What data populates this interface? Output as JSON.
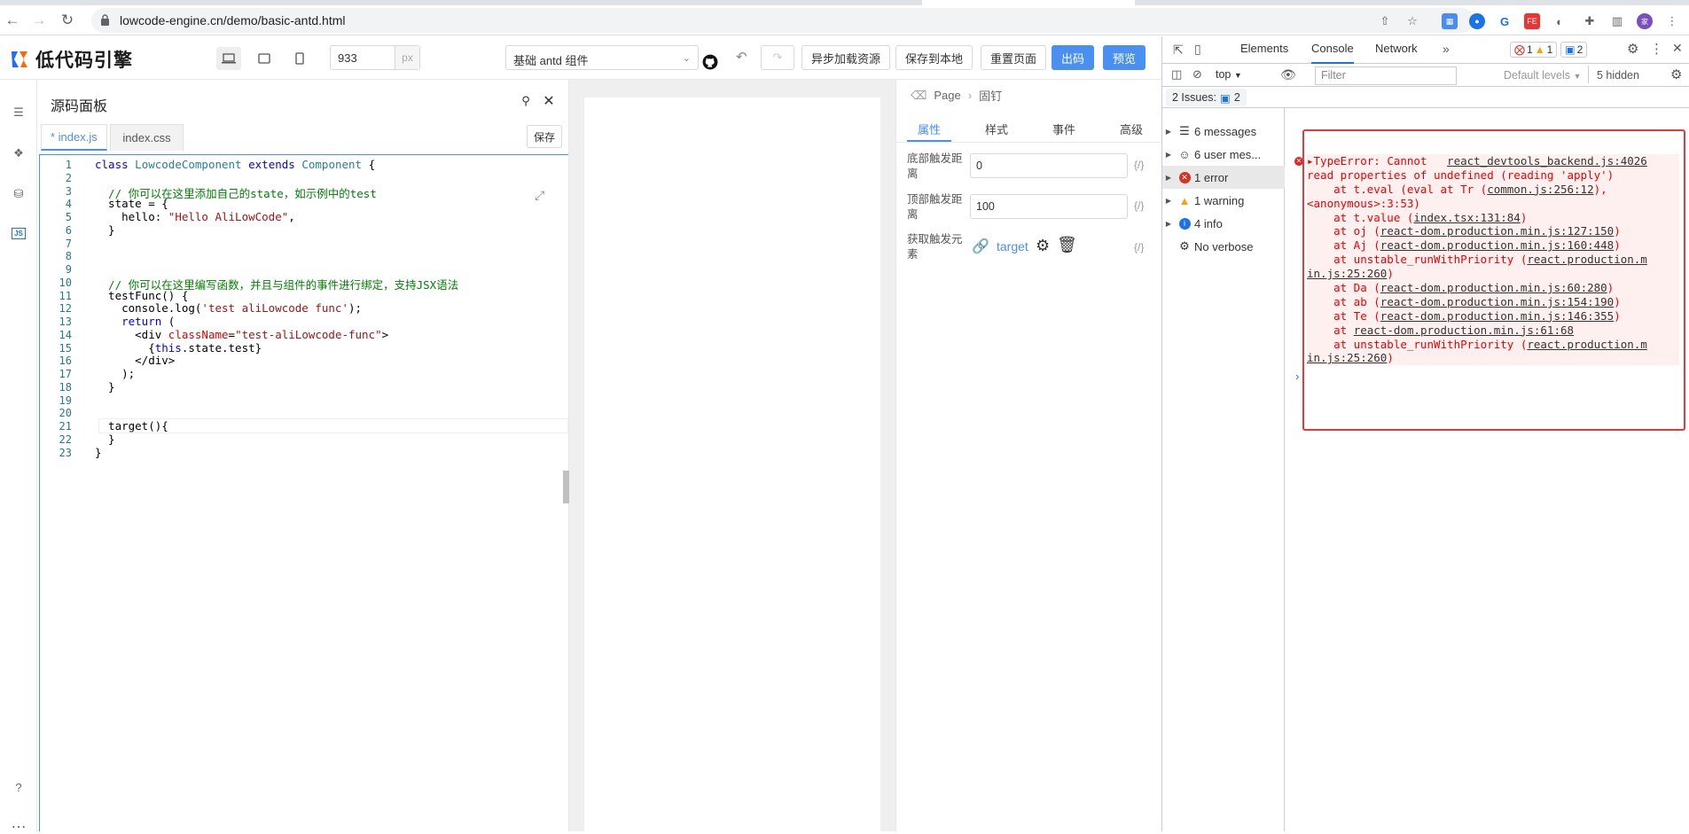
{
  "browser": {
    "url": "lowcode-engine.cn/demo/basic-antd.html"
  },
  "app": {
    "logo_text": "低代码引擎",
    "width_value": "933",
    "width_unit": "px",
    "component_select": "基础 antd 组件",
    "buttons": {
      "async_load": "异步加载资源",
      "save_local": "保存到本地",
      "reset_page": "重置页面",
      "export": "出码",
      "preview": "预览"
    }
  },
  "source_panel": {
    "title": "源码面板",
    "tabs": [
      "* index.js",
      "index.css"
    ],
    "save_label": "保存",
    "code_lines": [
      "1",
      "2",
      "3",
      "4",
      "5",
      "6",
      "7",
      "8",
      "9",
      "10",
      "11",
      "12",
      "13",
      "14",
      "15",
      "16",
      "17",
      "18",
      "19",
      "20",
      "21",
      "22",
      "23"
    ],
    "code": {
      "l1_kw": "class",
      "l1_cls": "LowcodeComponent",
      "l1_kw2": "extends",
      "l1_cls2": "Component",
      "l1_end": " {",
      "l3": "  // 你可以在这里添加自己的state，如示例中的test",
      "l4": "  state = {",
      "l5a": "    hello: ",
      "l5b": "\"Hello AliLowCode\"",
      "l5c": ",",
      "l6": "  }",
      "l10": "  // 你可以在这里编写函数，并且与组件的事件进行绑定，支持JSX语法",
      "l11": "  testFunc() {",
      "l12a": "    console.log(",
      "l12b": "'test aliLowcode func'",
      "l12c": ");",
      "l13a": "    ",
      "l13b": "return",
      "l13c": " (",
      "l14a": "      <div ",
      "l14b": "className",
      "l14c": "=",
      "l14d": "\"test-aliLowcode-func\"",
      "l14e": ">",
      "l15a": "        {",
      "l15b": "this",
      "l15c": ".state.test}",
      "l16": "      </div>",
      "l17": "    );",
      "l18": "  }",
      "l21": "  target(){",
      "l22": "  }",
      "l23": "}"
    }
  },
  "settings": {
    "breadcrumb": [
      "Page",
      "固钉"
    ],
    "tabs": [
      "属性",
      "样式",
      "事件",
      "高级"
    ],
    "fields": {
      "bottom_label": "底部触发距离",
      "bottom_value": "0",
      "top_label": "顶部触发距离",
      "top_value": "100",
      "target_label": "获取触发元素",
      "target_value": "target",
      "fx": "{/}"
    }
  },
  "devtools": {
    "tabs": [
      "Elements",
      "Console",
      "Network"
    ],
    "error_count": "1",
    "warning_count": "1",
    "message_count": "2",
    "context": "top",
    "filter_placeholder": "Filter",
    "levels": "Default levels",
    "hidden": "5 hidden",
    "issues_label": "2 Issues:",
    "issues_count": "2",
    "sidebar": [
      "6 messages",
      "6 user mes...",
      "1 error",
      "1 warning",
      "4 info",
      "No verbose"
    ],
    "error_lines": [
      {
        "text": "TypeError: Cannot   ",
        "link": "react_devtools_backend.js:4026"
      },
      {
        "text": "read properties of undefined (reading 'apply')",
        "link": ""
      },
      {
        "text": "    at t.eval (eval at Tr (",
        "link": "common.js:256:12",
        "tail": "),"
      },
      {
        "text": "<anonymous>:3:53)",
        "link": ""
      },
      {
        "text": "    at t.value (",
        "link": "index.tsx:131:84",
        "tail": ")"
      },
      {
        "text": "    at oj (",
        "link": "react-dom.production.min.js:127:150",
        "tail": ")"
      },
      {
        "text": "    at Aj (",
        "link": "react-dom.production.min.js:160:448",
        "tail": ")"
      },
      {
        "text": "    at unstable_runWithPriority (",
        "link": "react.production.m",
        "tail": ""
      },
      {
        "text": "",
        "link": "in.js:25:260",
        "tail": ")"
      },
      {
        "text": "    at Da (",
        "link": "react-dom.production.min.js:60:280",
        "tail": ")"
      },
      {
        "text": "    at ab (",
        "link": "react-dom.production.min.js:154:190",
        "tail": ")"
      },
      {
        "text": "    at Te (",
        "link": "react-dom.production.min.js:146:355",
        "tail": ")"
      },
      {
        "text": "    at ",
        "link": "react-dom.production.min.js:61:68",
        "tail": ""
      },
      {
        "text": "    at unstable_runWithPriority (",
        "link": "react.production.m",
        "tail": ""
      },
      {
        "text": "",
        "link": "in.js:25:260",
        "tail": ")"
      }
    ]
  },
  "colors": {
    "accent": "#4a90f0",
    "error": "#e53a3a"
  }
}
